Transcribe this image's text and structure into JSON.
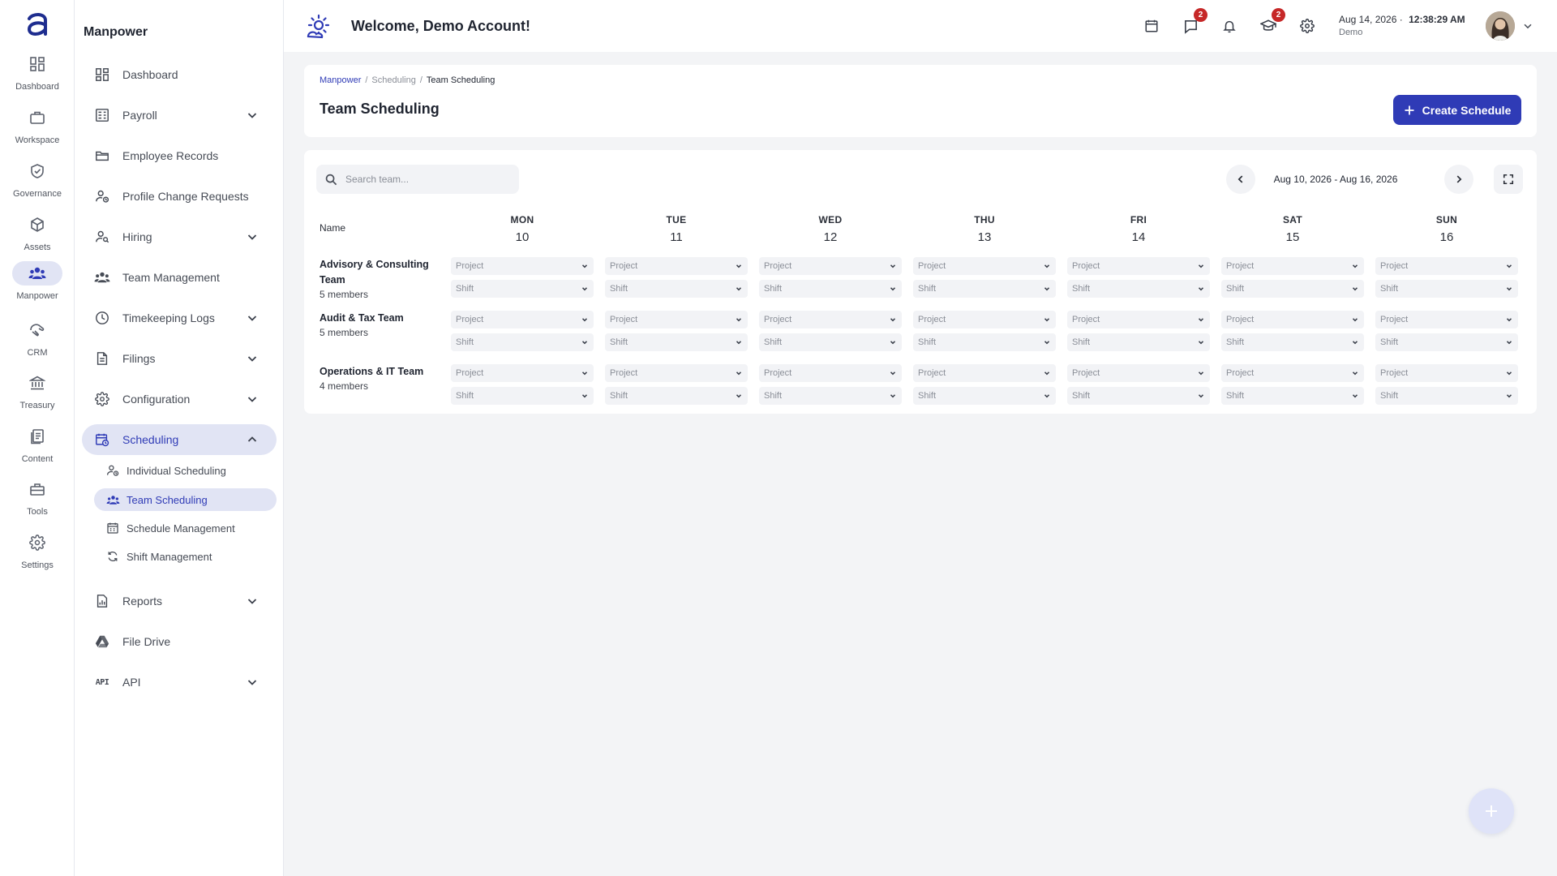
{
  "rail": {
    "items": [
      {
        "label": "Dashboard",
        "icon": "dashboard-icon"
      },
      {
        "label": "Workspace",
        "icon": "briefcase-icon"
      },
      {
        "label": "Governance",
        "icon": "shield-icon"
      },
      {
        "label": "Assets",
        "icon": "cube-icon"
      },
      {
        "label": "Manpower",
        "icon": "people-icon"
      },
      {
        "label": "CRM",
        "icon": "handshake-icon"
      },
      {
        "label": "Treasury",
        "icon": "bank-icon"
      },
      {
        "label": "Content",
        "icon": "document-icon"
      },
      {
        "label": "Tools",
        "icon": "toolbox-icon"
      },
      {
        "label": "Settings",
        "icon": "gear-icon"
      }
    ],
    "active": "Manpower"
  },
  "sidenav": {
    "title": "Manpower",
    "items": [
      {
        "label": "Dashboard",
        "icon": "dashboard-icon"
      },
      {
        "label": "Payroll",
        "icon": "payroll-icon"
      },
      {
        "label": "Employee Records",
        "icon": "folder-icon"
      },
      {
        "label": "Profile Change Requests",
        "icon": "user-change-icon"
      },
      {
        "label": "Hiring",
        "icon": "user-search-icon"
      },
      {
        "label": "Team Management",
        "icon": "team-icon"
      },
      {
        "label": "Timekeeping Logs",
        "icon": "clock-icon"
      },
      {
        "label": "Filings",
        "icon": "file-icon"
      },
      {
        "label": "Configuration",
        "icon": "gear-icon"
      },
      {
        "label": "Scheduling",
        "icon": "calendar-clock-icon"
      },
      {
        "label": "Reports",
        "icon": "report-icon"
      },
      {
        "label": "File Drive",
        "icon": "drive-icon"
      },
      {
        "label": "API",
        "icon": "api-icon"
      }
    ],
    "scheduling_sub": [
      {
        "label": "Individual Scheduling",
        "icon": "user-clock-icon"
      },
      {
        "label": "Team Scheduling",
        "icon": "team-icon"
      },
      {
        "label": "Schedule Management",
        "icon": "calendar-icon"
      },
      {
        "label": "Shift Management",
        "icon": "refresh-icon"
      }
    ]
  },
  "topbar": {
    "welcome": "Welcome, Demo Account!",
    "messages_badge": "2",
    "learning_badge": "2",
    "date": "Aug 14, 2026",
    "separator": "·",
    "time": "12:38:29 AM",
    "user": "Demo"
  },
  "page": {
    "breadcrumb": [
      "Manpower",
      "Scheduling",
      "Team Scheduling"
    ],
    "crumb_sep": "/",
    "title": "Team Scheduling",
    "create_label": "Create Schedule"
  },
  "schedule": {
    "search_placeholder": "Search team...",
    "date_range": "Aug 10, 2026 - Aug 16, 2026",
    "name_header": "Name",
    "days": [
      {
        "name": "MON",
        "num": "10"
      },
      {
        "name": "TUE",
        "num": "11"
      },
      {
        "name": "WED",
        "num": "12"
      },
      {
        "name": "THU",
        "num": "13"
      },
      {
        "name": "FRI",
        "num": "14"
      },
      {
        "name": "SAT",
        "num": "15"
      },
      {
        "name": "SUN",
        "num": "16"
      }
    ],
    "project_placeholder": "Project",
    "shift_placeholder": "Shift",
    "teams": [
      {
        "name": "Advisory & Consulting Team",
        "members": "5 members"
      },
      {
        "name": "Audit & Tax Team",
        "members": "5 members"
      },
      {
        "name": "Operations & IT Team",
        "members": "4 members"
      }
    ]
  },
  "colors": {
    "accent": "#2f3bb6",
    "active_bg": "#e1e4f4",
    "badge": "#c62828",
    "fab": "#dfe3f8"
  }
}
